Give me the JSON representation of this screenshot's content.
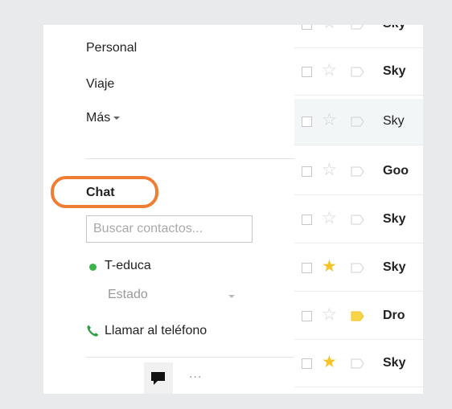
{
  "nav": {
    "labels": [
      "Personal",
      "Viaje"
    ],
    "more_label": "Más"
  },
  "chat": {
    "title": "Chat",
    "search_placeholder": "Buscar contactos...",
    "contact": {
      "name": "T-educa",
      "presence_color": "#3bb54a"
    },
    "status_label": "Estado",
    "phone_label": "Llamar al teléfono",
    "more_glyph": "..."
  },
  "highlight_color": "#ef7d33",
  "messages": [
    {
      "sender": "Sky",
      "bold": true,
      "starred": false,
      "tagged": false
    },
    {
      "sender": "Sky",
      "bold": true,
      "starred": false,
      "tagged": false
    },
    {
      "sender": "Sky",
      "bold": false,
      "starred": false,
      "tagged": false
    },
    {
      "sender": "Goo",
      "bold": true,
      "starred": false,
      "tagged": false
    },
    {
      "sender": "Sky",
      "bold": true,
      "starred": false,
      "tagged": false
    },
    {
      "sender": "Sky",
      "bold": true,
      "starred": true,
      "tagged": false
    },
    {
      "sender": "Dro",
      "bold": true,
      "starred": false,
      "tagged": true
    },
    {
      "sender": "Sky",
      "bold": true,
      "starred": true,
      "tagged": false
    }
  ],
  "icons": {
    "star": "star-icon",
    "tag": "label-tag-icon",
    "phone": "phone-icon",
    "chat": "chat-bubble-icon"
  }
}
